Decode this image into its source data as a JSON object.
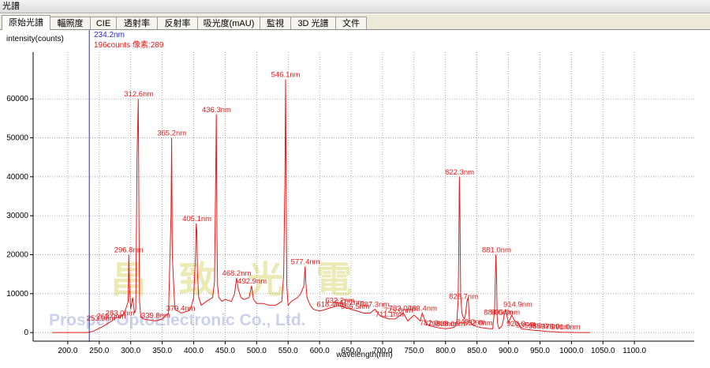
{
  "window": {
    "title": "光譜"
  },
  "tabs": [
    {
      "label": "原始光譜",
      "active": true
    },
    {
      "label": "輻照度",
      "active": false
    },
    {
      "label": "CIE",
      "active": false
    },
    {
      "label": "透射率",
      "active": false
    },
    {
      "label": "反射率",
      "active": false
    },
    {
      "label": "吸光度(mAU)",
      "active": false
    },
    {
      "label": "監視",
      "active": false
    },
    {
      "label": "3D 光譜",
      "active": false
    },
    {
      "label": "文件",
      "active": false
    }
  ],
  "cursor": {
    "wavelength_label": "234.2nm",
    "value_label": "196counts 像素:289",
    "x": 234.2
  },
  "watermark": {
    "cn": "昌 致 光 電",
    "en": "Prosper OptoElectronic Co., Ltd."
  },
  "colors": {
    "spectrum": "#e31a1a",
    "cursor": "#2b2bd4",
    "grid": "#888888"
  },
  "chart_data": {
    "type": "line",
    "xlabel": "wavelength(nm)",
    "ylabel": "intensity(counts)",
    "xlim": [
      145,
      1195
    ],
    "ylim": [
      -2200,
      72000
    ],
    "xticks": [
      200,
      250,
      300,
      350,
      400,
      450,
      500,
      550,
      600,
      650,
      700,
      750,
      800,
      850,
      900,
      950,
      1000,
      1050,
      1100
    ],
    "xtick_labels": [
      "200.0",
      "250.0",
      "300.0",
      "350.0",
      "400.0",
      "450.0",
      "500.0",
      "550.0",
      "600.0",
      "650.0",
      "700.0",
      "750.0",
      "800.0",
      "850.0",
      "900.0",
      "950.0",
      "1000.0",
      "1050.0",
      "1100.0"
    ],
    "yticks": [
      0,
      10000,
      20000,
      30000,
      40000,
      50000,
      60000
    ],
    "ytick_labels": [
      "0",
      "10000",
      "20000",
      "30000",
      "40000",
      "50000",
      "60000"
    ],
    "grid": true,
    "series": [
      {
        "x": [
          175,
          230,
          240,
          255,
          265,
          270,
          278,
          283,
          290,
          296,
          297,
          298,
          300,
          303,
          306,
          308,
          310,
          312,
          313,
          314,
          316,
          320,
          330,
          340,
          350,
          360,
          364,
          365,
          366,
          370,
          380,
          390,
          395,
          400,
          403,
          404,
          405,
          406,
          408,
          412,
          420,
          430,
          433,
          435,
          436,
          437,
          438,
          440,
          445,
          450,
          460,
          465,
          468,
          471,
          475,
          480,
          488,
          492,
          495,
          500,
          510,
          520,
          530,
          540,
          543,
          545,
          546,
          547,
          548,
          550,
          555,
          560,
          565,
          570,
          575,
          577,
          578,
          580,
          585,
          590,
          600,
          610,
          620,
          630,
          640,
          650,
          660,
          670,
          680,
          688,
          695,
          700,
          710,
          720,
          733,
          740,
          750,
          760,
          763,
          770,
          780,
          790,
          800,
          810,
          815,
          818,
          820,
          821,
          822,
          823,
          824,
          826,
          828,
          830,
          832,
          834,
          836,
          838,
          842,
          850,
          860,
          870,
          875,
          878,
          880,
          881,
          882,
          883,
          885,
          890,
          895,
          900,
          905,
          910,
          915,
          920,
          930,
          940,
          950,
          960,
          975,
          985,
          1000,
          1010,
          1030
        ],
        "y": [
          0,
          0,
          300,
          1500,
          2500,
          3000,
          4000,
          3800,
          5000,
          8000,
          20000,
          12000,
          6000,
          9000,
          5000,
          6000,
          45000,
          60000,
          30000,
          8000,
          4000,
          3500,
          3200,
          3000,
          3500,
          5000,
          30000,
          50000,
          20000,
          6000,
          5000,
          5500,
          6000,
          9000,
          20000,
          28000,
          26000,
          15000,
          9000,
          7000,
          8000,
          9000,
          13000,
          40000,
          56000,
          25000,
          12000,
          9000,
          8000,
          8500,
          8000,
          10000,
          14000,
          11000,
          9000,
          8500,
          9000,
          12000,
          8500,
          7500,
          7500,
          7000,
          7000,
          8000,
          15000,
          40000,
          65000,
          35000,
          12000,
          7000,
          8000,
          8500,
          9000,
          10000,
          12000,
          17000,
          13000,
          9000,
          7000,
          6000,
          5500,
          6000,
          6500,
          7000,
          6500,
          6000,
          5500,
          5000,
          5000,
          6000,
          4500,
          4000,
          3500,
          3500,
          5000,
          3000,
          4500,
          3000,
          5000,
          2000,
          1500,
          1200,
          1000,
          1200,
          1500,
          3000,
          8000,
          20000,
          40000,
          30000,
          10000,
          5000,
          4000,
          3500,
          5000,
          8000,
          9000,
          3000,
          2000,
          1500,
          1200,
          1000,
          1000,
          6000,
          20000,
          15000,
          4000,
          2000,
          1000,
          1800,
          6000,
          2500,
          4500,
          3000,
          2500,
          1000,
          800,
          600,
          500,
          300,
          200,
          100,
          50,
          0,
          0
        ]
      }
    ],
    "annotations": [
      {
        "x": 253.0,
        "y": 2500,
        "label": "253.0nm"
      },
      {
        "x": 269.0,
        "y": 3000,
        "label": "269.0nm"
      },
      {
        "x": 283.0,
        "y": 3800,
        "label": "283.0nm"
      },
      {
        "x": 296.8,
        "y": 20000,
        "label": "296.8nm"
      },
      {
        "x": 312.6,
        "y": 60000,
        "label": "312.6nm"
      },
      {
        "x": 339.8,
        "y": 3200,
        "label": "339.8nm"
      },
      {
        "x": 365.2,
        "y": 50000,
        "label": "365.2nm"
      },
      {
        "x": 379.4,
        "y": 5000,
        "label": "379.4nm"
      },
      {
        "x": 405.1,
        "y": 28000,
        "label": "405.1nm"
      },
      {
        "x": 436.3,
        "y": 56000,
        "label": "436.3nm"
      },
      {
        "x": 468.2,
        "y": 14000,
        "label": "468.2nm"
      },
      {
        "x": 492.9,
        "y": 12000,
        "label": "492.9nm"
      },
      {
        "x": 546.1,
        "y": 65000,
        "label": "546.1nm"
      },
      {
        "x": 577.4,
        "y": 17000,
        "label": "577.4nm"
      },
      {
        "x": 618.4,
        "y": 6000,
        "label": "618.4nm"
      },
      {
        "x": 632.2,
        "y": 7000,
        "label": "632.2nm"
      },
      {
        "x": 647.2,
        "y": 6500,
        "label": "647.2nm"
      },
      {
        "x": 656.5,
        "y": 5500,
        "label": "656.5nm"
      },
      {
        "x": 687.3,
        "y": 6000,
        "label": "687.3nm"
      },
      {
        "x": 711.1,
        "y": 3500,
        "label": "711.1nm"
      },
      {
        "x": 725.0,
        "y": 4500,
        "label": "725.0nm"
      },
      {
        "x": 733.0,
        "y": 5000,
        "label": "733.0nm"
      },
      {
        "x": 763.4,
        "y": 5000,
        "label": "763.4nm"
      },
      {
        "x": 782.0,
        "y": 1200,
        "label": "782.0nm"
      },
      {
        "x": 795.0,
        "y": 1000,
        "label": "795.0nm"
      },
      {
        "x": 808.0,
        "y": 1000,
        "label": "808.0nm"
      },
      {
        "x": 822.3,
        "y": 40000,
        "label": "822.3nm"
      },
      {
        "x": 828.7,
        "y": 8000,
        "label": "828.7nm"
      },
      {
        "x": 840.0,
        "y": 1500,
        "label": "840.0nm"
      },
      {
        "x": 852.0,
        "y": 1200,
        "label": "852.0nm"
      },
      {
        "x": 881.0,
        "y": 20000,
        "label": "881.0nm"
      },
      {
        "x": 884.0,
        "y": 4000,
        "label": "884.0nm"
      },
      {
        "x": 895.0,
        "y": 4000,
        "label": "895.0nm"
      },
      {
        "x": 914.9,
        "y": 6000,
        "label": "914.9nm"
      },
      {
        "x": 920.0,
        "y": 1000,
        "label": "920.0nm"
      },
      {
        "x": 935.0,
        "y": 600,
        "label": "935.0nm"
      },
      {
        "x": 955.0,
        "y": 400,
        "label": "955.0nm"
      },
      {
        "x": 975.0,
        "y": 300,
        "label": "975.0nm"
      },
      {
        "x": 991.0,
        "y": 200,
        "label": "991.0nm"
      }
    ]
  }
}
